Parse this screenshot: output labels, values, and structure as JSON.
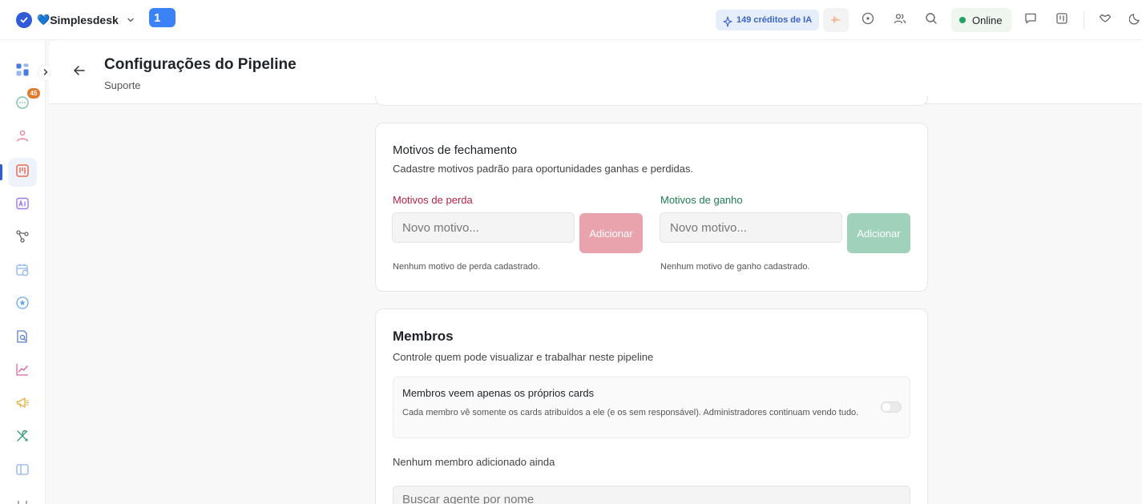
{
  "topbar": {
    "workspace_heart": "💙",
    "workspace_name": "Simplesdesk",
    "tab_number": "1",
    "ai_credits": "149 créditos de IA",
    "status": "Online"
  },
  "sidebar": {
    "notification_count": "45",
    "items": [
      "dashboard-icon",
      "chat-icon",
      "contacts-icon",
      "pipeline-icon",
      "ai-assistant-icon",
      "flows-icon",
      "schedule-icon",
      "star-icon",
      "knowledge-icon",
      "reports-icon",
      "campaigns-icon",
      "tools-icon",
      "layout-icon",
      "bot-icon"
    ]
  },
  "header": {
    "title": "Configurações do Pipeline",
    "subtitle": "Suporte"
  },
  "closing_reasons": {
    "title": "Motivos de fechamento",
    "description": "Cadastre motivos padrão para oportunidades ganhas e perdidas.",
    "loss": {
      "label": "Motivos de perda",
      "placeholder": "Novo motivo...",
      "button": "Adicionar",
      "empty": "Nenhum motivo de perda cadastrado."
    },
    "win": {
      "label": "Motivos de ganho",
      "placeholder": "Novo motivo...",
      "button": "Adicionar",
      "empty": "Nenhum motivo de ganho cadastrado."
    }
  },
  "members": {
    "title": "Membros",
    "description": "Controle quem pode visualizar e trabalhar neste pipeline",
    "toggle_title": "Membros veem apenas os próprios cards",
    "toggle_description": "Cada membro vê somente os cards atribuídos a ele (e os sem responsável). Administradores continuam vendo tudo.",
    "toggle_on": false,
    "empty": "Nenhum membro adicionado ainda",
    "search_placeholder": "Buscar agente por nome"
  }
}
